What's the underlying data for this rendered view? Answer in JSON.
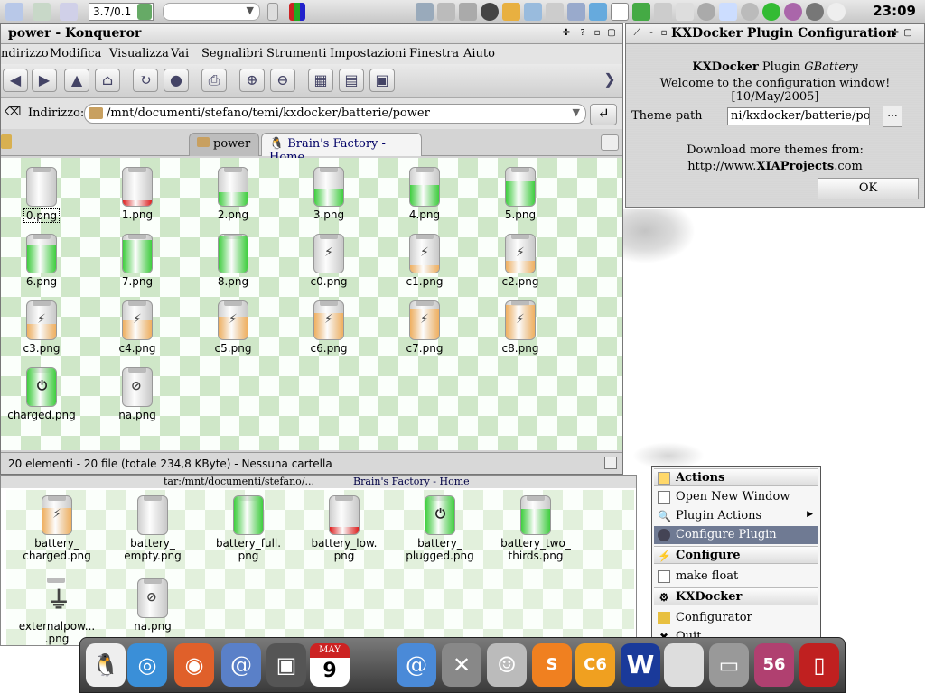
{
  "top_panel": {
    "load_value": "3.7/0.1",
    "clock": "23:09"
  },
  "konqueror": {
    "title": "power - Konqueror",
    "menu": [
      "ndirizzo",
      "Modifica",
      "Visualizza",
      "Vai",
      "Segnalibri",
      "Strumenti",
      "Impostazioni",
      "Finestra",
      "Aiuto"
    ],
    "location_label": "Indirizzo:",
    "location_value": "/mnt/documenti/stefano/temi/kxdocker/batterie/power",
    "tabs": [
      "power",
      "Brain's Factory - Home"
    ],
    "files": [
      {
        "name": "0.png",
        "level": 0,
        "kind": "empty"
      },
      {
        "name": "1.png",
        "level": 0.15,
        "kind": "red"
      },
      {
        "name": "2.png",
        "level": 0.35,
        "kind": "green"
      },
      {
        "name": "3.png",
        "level": 0.45,
        "kind": "green"
      },
      {
        "name": "4.png",
        "level": 0.55,
        "kind": "green"
      },
      {
        "name": "5.png",
        "level": 0.65,
        "kind": "green"
      },
      {
        "name": "6.png",
        "level": 0.75,
        "kind": "green"
      },
      {
        "name": "7.png",
        "level": 0.85,
        "kind": "green"
      },
      {
        "name": "8.png",
        "level": 0.95,
        "kind": "green"
      },
      {
        "name": "c0.png",
        "level": 0,
        "kind": "charge"
      },
      {
        "name": "c1.png",
        "level": 0.2,
        "kind": "charge"
      },
      {
        "name": "c2.png",
        "level": 0.3,
        "kind": "charge"
      },
      {
        "name": "c3.png",
        "level": 0.4,
        "kind": "charge"
      },
      {
        "name": "c4.png",
        "level": 0.5,
        "kind": "charge"
      },
      {
        "name": "c5.png",
        "level": 0.6,
        "kind": "charge"
      },
      {
        "name": "c6.png",
        "level": 0.7,
        "kind": "charge"
      },
      {
        "name": "c7.png",
        "level": 0.8,
        "kind": "charge"
      },
      {
        "name": "c8.png",
        "level": 0.9,
        "kind": "charge"
      },
      {
        "name": "charged.png",
        "level": 1,
        "kind": "plug"
      },
      {
        "name": "na.png",
        "level": 0,
        "kind": "na"
      }
    ],
    "status": "20 elementi - 20 file (totale 234,8 KByte) - Nessuna cartella"
  },
  "konqueror_back": {
    "tab_text_1": "tar:/mnt/documenti/stefano/...",
    "tab_text_2": "Brain's Factory - Home",
    "files": [
      {
        "name": "battery_\ncharged.png",
        "kind": "charge",
        "level": 0.7
      },
      {
        "name": "battery_\nempty.png",
        "kind": "empty",
        "level": 0
      },
      {
        "name": "battery_full.\npng",
        "kind": "green",
        "level": 1
      },
      {
        "name": "battery_low.\npng",
        "kind": "red",
        "level": 0.2
      },
      {
        "name": "battery_\nplugged.png",
        "kind": "plug",
        "level": 1
      },
      {
        "name": "battery_two_\nthirds.png",
        "kind": "green",
        "level": 0.66
      },
      {
        "name": "externalpow...\n.png",
        "kind": "cable",
        "level": 0
      },
      {
        "name": "na.png",
        "kind": "na",
        "level": 0
      }
    ]
  },
  "kxdocker_config": {
    "title": "KXDocker Plugin Configuration",
    "heading_bold": "KXDocker",
    "heading_plain": " Plugin ",
    "heading_italic": "GBattery",
    "welcome": "Welcome to the configuration window! [10/May/2005]",
    "theme_path_label": "Theme path",
    "theme_path_value": "ni/kxdocker/batterie/power",
    "browse_label": "...",
    "download_line": "Download more themes from:",
    "url_prefix": "http://www.",
    "url_bold": "XIAProjects",
    "url_suffix": ".com",
    "ok_label": "OK"
  },
  "context_menu": {
    "sections": [
      {
        "header": "Actions",
        "items": [
          "Open New Window",
          "Plugin Actions",
          "Configure Plugin"
        ]
      },
      {
        "header": "Configure",
        "items": [
          "make float"
        ]
      },
      {
        "header": "KXDocker",
        "items": [
          "Configurator",
          "Quit"
        ]
      }
    ],
    "highlighted": "Configure Plugin"
  },
  "dock": {
    "icons": [
      "tux-icon",
      "safari-icon",
      "firefox-icon",
      "mail-icon",
      "terminal-icon",
      "calendar-icon",
      "kmail-icon",
      "tools-icon",
      "chat-icon",
      "skype-icon",
      "c6-icon",
      "word-icon",
      "apple-icon",
      "drive-icon",
      "game-icon",
      "battery-icon"
    ],
    "calendar_month": "MAY",
    "calendar_day": "9"
  },
  "colors": {
    "menu_highlight": "#6f7a93",
    "battery_green": "#3fcf3f",
    "battery_red": "#e02020",
    "battery_charge": "#f0b060"
  }
}
